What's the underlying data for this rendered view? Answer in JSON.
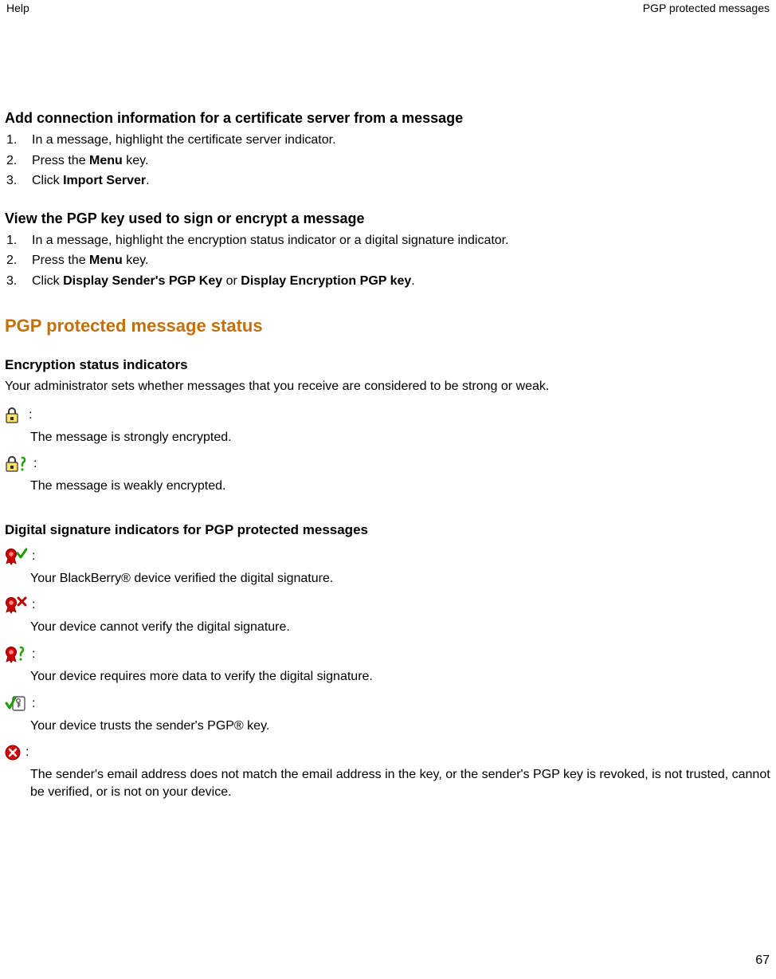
{
  "header": {
    "left": "Help",
    "right": "PGP protected messages"
  },
  "section1": {
    "title": "Add connection information for a certificate server from a message",
    "steps": [
      {
        "num": "1.",
        "pre": "In a message, highlight the certificate server indicator.",
        "bold1": "",
        "mid": "",
        "bold2": "",
        "post": ""
      },
      {
        "num": "2.",
        "pre": "Press the ",
        "bold1": "Menu",
        "mid": " key.",
        "bold2": "",
        "post": ""
      },
      {
        "num": "3.",
        "pre": "Click ",
        "bold1": "Import Server",
        "mid": ".",
        "bold2": "",
        "post": ""
      }
    ]
  },
  "section2": {
    "title": "View the PGP key used to sign or encrypt a message",
    "steps": [
      {
        "num": "1.",
        "pre": "In a message, highlight the encryption status indicator or a digital signature indicator.",
        "bold1": "",
        "mid": "",
        "bold2": "",
        "post": ""
      },
      {
        "num": "2.",
        "pre": "Press the ",
        "bold1": "Menu",
        "mid": " key.",
        "bold2": "",
        "post": ""
      },
      {
        "num": "3.",
        "pre": "Click ",
        "bold1": "Display Sender's PGP Key",
        "mid": " or ",
        "bold2": "Display Encryption PGP key",
        "post": "."
      }
    ]
  },
  "big_heading": "PGP protected message status",
  "enc_section": {
    "title": "Encryption status indicators",
    "intro": "Your administrator sets whether messages that you receive are considered to be strong or weak.",
    "items": [
      {
        "desc": "The message is strongly encrypted."
      },
      {
        "desc": "The message is weakly encrypted."
      }
    ]
  },
  "sig_section": {
    "title": "Digital signature indicators for PGP protected messages",
    "items": [
      {
        "desc": "Your BlackBerry® device verified the digital signature."
      },
      {
        "desc": "Your device cannot verify the digital signature."
      },
      {
        "desc": "Your device requires more data to verify the digital signature."
      },
      {
        "desc": "Your device trusts the sender's PGP® key."
      },
      {
        "desc": "The sender's email address does not match the email address in the key, or the sender's PGP key is revoked, is not trusted, cannot be verified, or is not on your device."
      }
    ]
  },
  "page_number": "67",
  "colon": ":"
}
